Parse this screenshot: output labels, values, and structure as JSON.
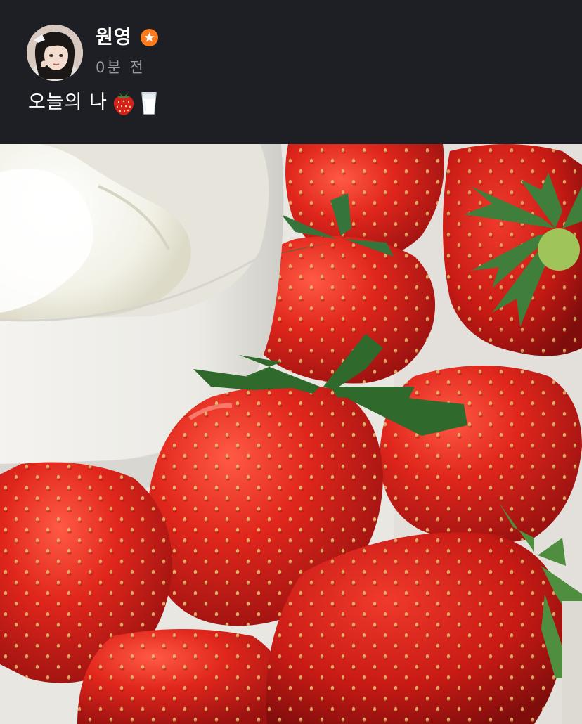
{
  "post": {
    "author": {
      "name": "원영",
      "verified_badge_icon": "star-badge-icon",
      "avatar_icon": "profile-photo"
    },
    "timestamp": "0분 전",
    "caption": {
      "text": "오늘의 나",
      "emojis": [
        "strawberry-emoji",
        "milk-glass-emoji"
      ]
    },
    "photo": {
      "subject": "strawberries-and-soft-serve-photo"
    }
  },
  "colors": {
    "background": "#1e1f24",
    "text_primary": "#ffffff",
    "text_secondary": "#9a9ba3",
    "badge": "#ff7a1a",
    "strawberry": "#d81e16",
    "leaf": "#2f6a2c"
  }
}
